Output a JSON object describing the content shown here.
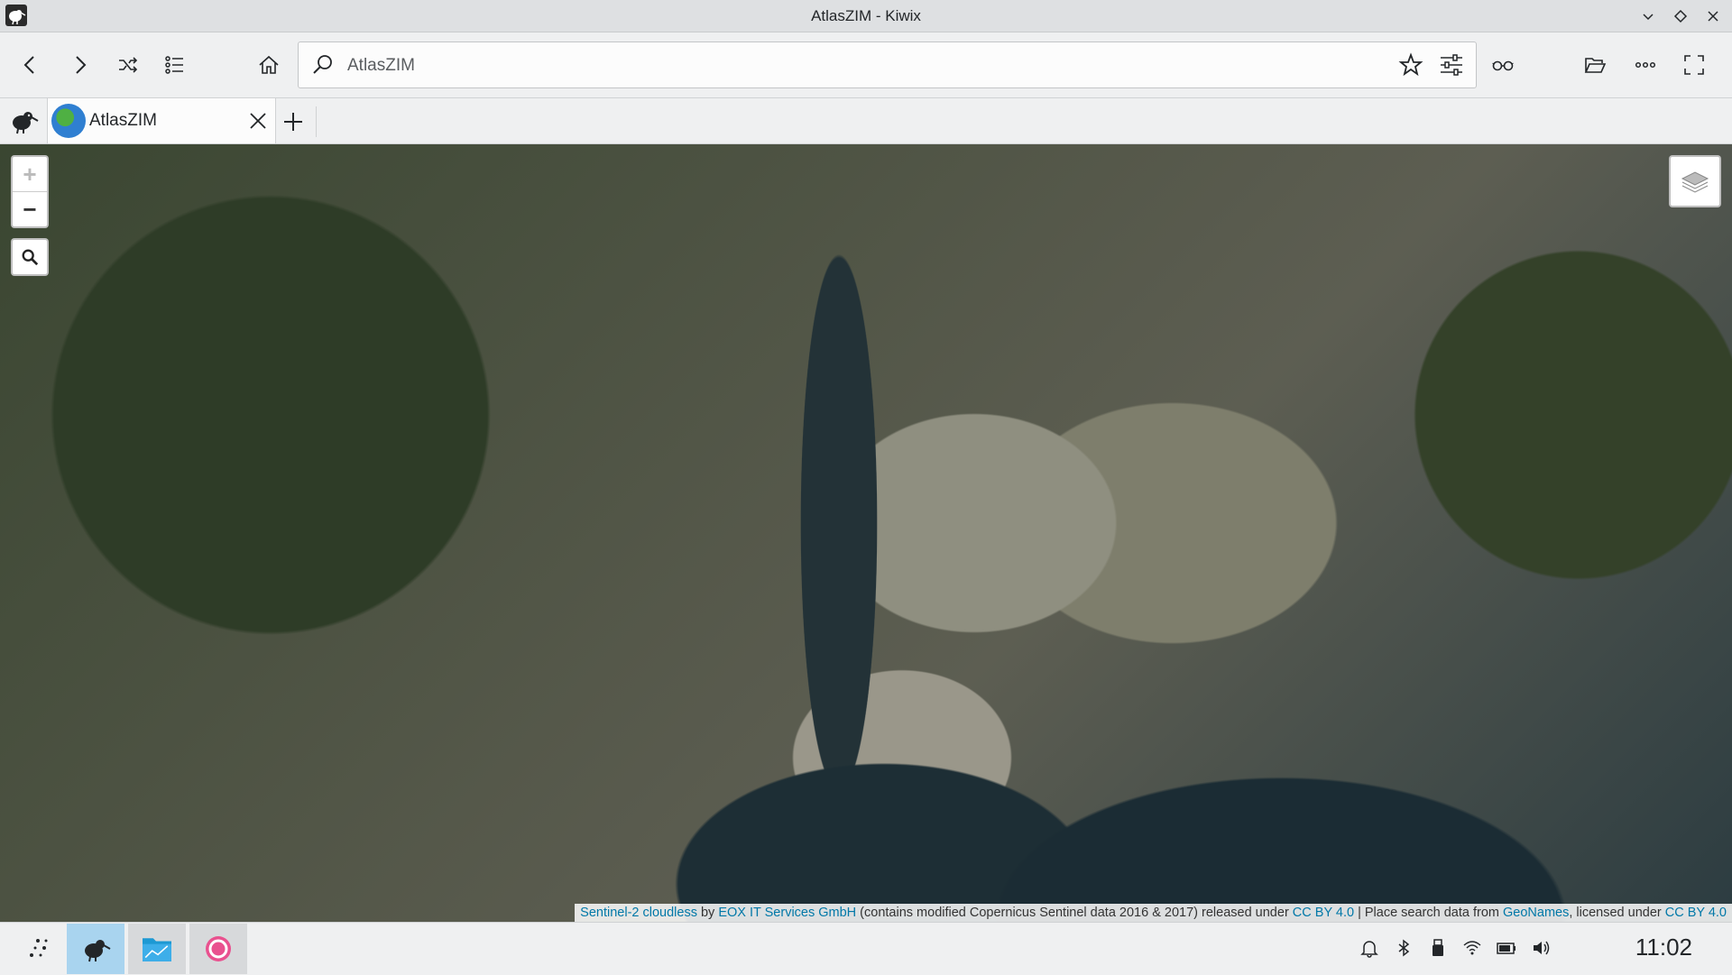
{
  "window": {
    "title": "AtlasZIM - Kiwix"
  },
  "toolbar": {
    "back_label": "Back",
    "forward_label": "Forward",
    "random_label": "Random article",
    "toc_label": "Table of contents",
    "home_label": "Home",
    "reading_label": "Reading mode",
    "open_label": "Open file",
    "more_label": "More",
    "fullscreen_label": "Fullscreen"
  },
  "search": {
    "value": "AtlasZIM",
    "placeholder": "Search"
  },
  "tabs": [
    {
      "label": "AtlasZIM"
    }
  ],
  "map": {
    "zoom_in": "+",
    "zoom_out": "−",
    "attribution": {
      "source": "Sentinel-2 cloudless",
      "by": " by ",
      "company": "EOX IT Services GmbH",
      "contains": " (contains modified Copernicus Sentinel data 2016 & 2017) released under ",
      "license1": "CC BY 4.0",
      "place": " | Place search data from ",
      "geonames": "GeoNames",
      "licensed": ", licensed under ",
      "license2": "CC BY 4.0"
    }
  },
  "taskbar": {
    "clock": "11:02"
  }
}
